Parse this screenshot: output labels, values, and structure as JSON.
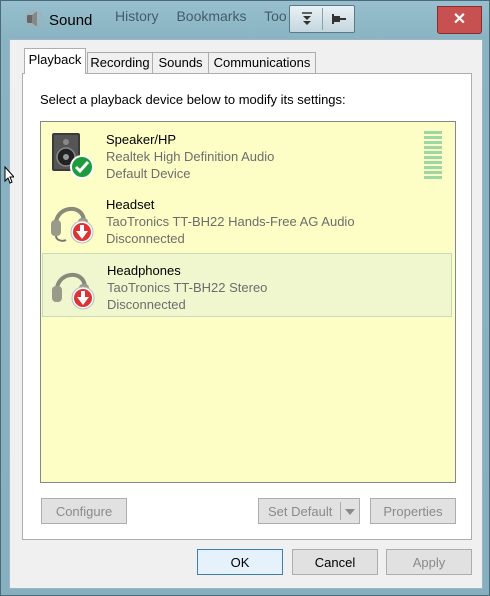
{
  "window": {
    "title": "Sound",
    "background_menu": [
      "History",
      "Bookmarks",
      "Too"
    ],
    "close_label": "✕"
  },
  "tabs": [
    {
      "label": "Playback",
      "active": true
    },
    {
      "label": "Recording",
      "active": false
    },
    {
      "label": "Sounds",
      "active": false
    },
    {
      "label": "Communications",
      "active": false
    }
  ],
  "instruction": "Select a playback device below to modify its settings:",
  "devices": [
    {
      "name": "Speaker/HP",
      "description": "Realtek High Definition Audio",
      "status": "Default Device",
      "icon": "speaker-icon",
      "badge": "check-badge-icon"
    },
    {
      "name": "Headset",
      "description": "TaoTronics TT-BH22 Hands-Free AG Audio",
      "status": "Disconnected",
      "icon": "headset-icon",
      "badge": "down-arrow-badge-icon"
    },
    {
      "name": "Headphones",
      "description": "TaoTronics TT-BH22 Stereo",
      "status": "Disconnected",
      "icon": "headphones-icon",
      "badge": "down-arrow-badge-icon"
    }
  ],
  "buttons": {
    "configure": "Configure",
    "set_default": "Set Default",
    "properties": "Properties",
    "ok": "OK",
    "cancel": "Cancel",
    "apply": "Apply"
  },
  "colors": {
    "list_background": "#fdfdc6",
    "selected_row": "#f0f7cf",
    "close_button": "#c75050",
    "level_meter": "#9ed6a4"
  }
}
